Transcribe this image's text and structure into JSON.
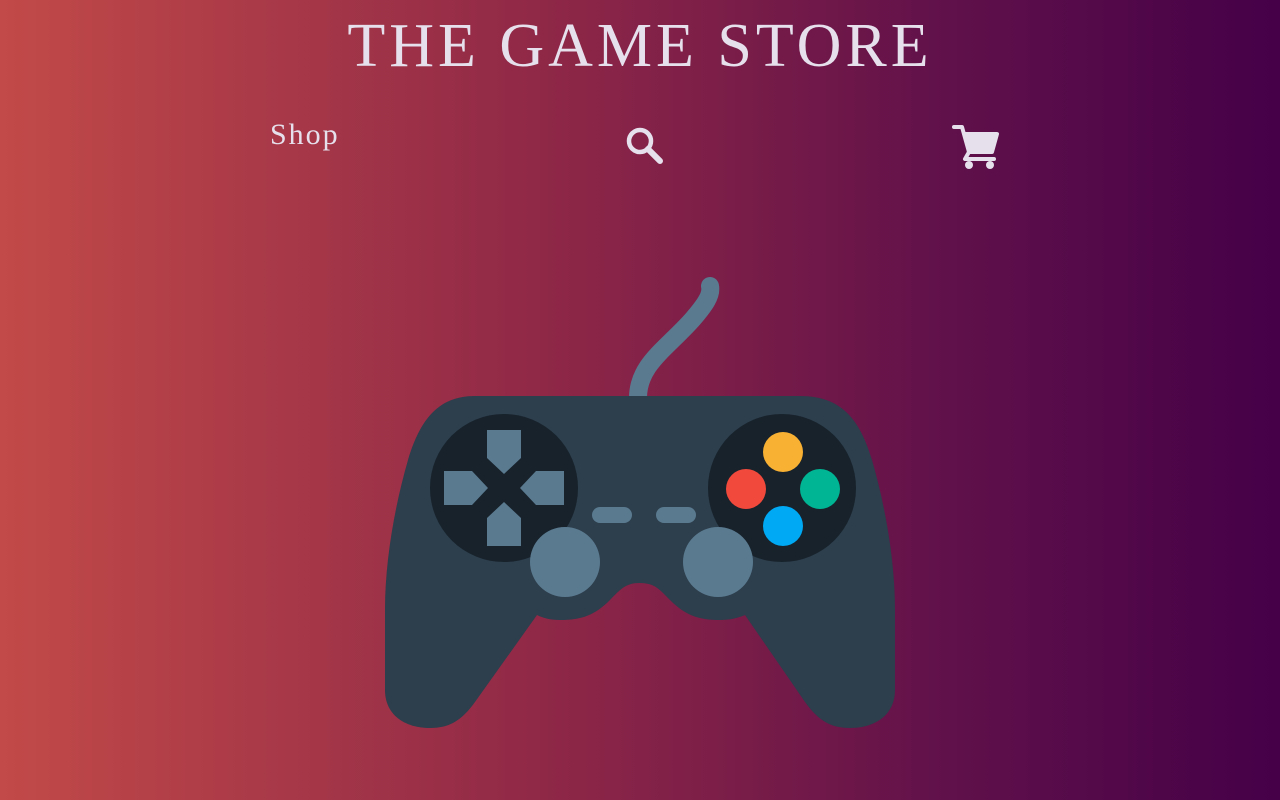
{
  "site": {
    "title": "THE GAME STORE"
  },
  "nav": {
    "shop_label": "Shop",
    "search_icon": "search-icon",
    "cart_icon": "cart-icon"
  },
  "hero": {
    "image": "gamepad-controller-illustration"
  },
  "colors": {
    "gradient_start": "#c24a48",
    "gradient_end": "#450048",
    "text": "#e6e0ec",
    "controller_body": "#2d3e4c",
    "controller_dark": "#17222b",
    "controller_accent": "#5a7a90",
    "button_yellow": "#f8b133",
    "button_red": "#f14a3c",
    "button_green": "#00b594",
    "button_blue": "#00a9f4"
  }
}
